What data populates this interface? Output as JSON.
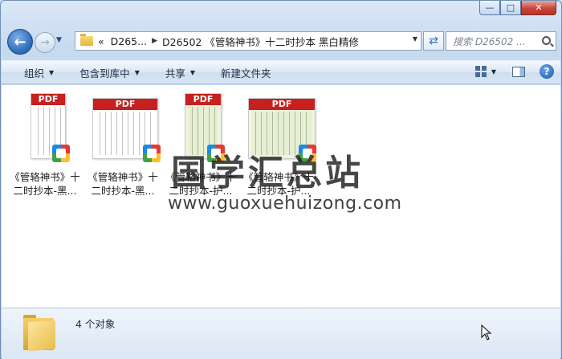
{
  "window": {
    "caption_buttons": [
      "minimize",
      "maximize",
      "close"
    ]
  },
  "nav": {
    "breadcrumb": [
      {
        "label": "D265..."
      },
      {
        "label": "D26502 《管辂神书》十二时抄本 黑白精修"
      }
    ],
    "overflow_label": "«",
    "search_placeholder": "搜索 D26502 ..."
  },
  "toolbar": {
    "commands": [
      {
        "label": "组织",
        "has_dropdown": true
      },
      {
        "label": "包含到库中",
        "has_dropdown": true
      },
      {
        "label": "共享",
        "has_dropdown": true
      },
      {
        "label": "新建文件夹",
        "has_dropdown": false
      }
    ]
  },
  "files": [
    {
      "label_line1": "《管辂神书》十",
      "label_line2": "二时抄本-黑...",
      "thumb_label": "PDF",
      "thumb_style": "white"
    },
    {
      "label_line1": "《管辂神书》十",
      "label_line2": "二时抄本-黑...",
      "thumb_label": "PDF",
      "thumb_style": "white"
    },
    {
      "label_line1": "《管辂神书》十",
      "label_line2": "二时抄本-护...",
      "thumb_label": "PDF",
      "thumb_style": "green"
    },
    {
      "label_line1": "《管辂神书》十",
      "label_line2": "二时抄本-护...",
      "thumb_label": "PDF",
      "thumb_style": "green"
    }
  ],
  "watermark": {
    "title": "国学汇总站",
    "url": "www.guoxuehuizong.com"
  },
  "details": {
    "item_count": "4 个对象"
  },
  "colors": {
    "pdf_band": "#c8201f",
    "window_frame": "#6f8fb5",
    "close_button": "#c7463a"
  }
}
